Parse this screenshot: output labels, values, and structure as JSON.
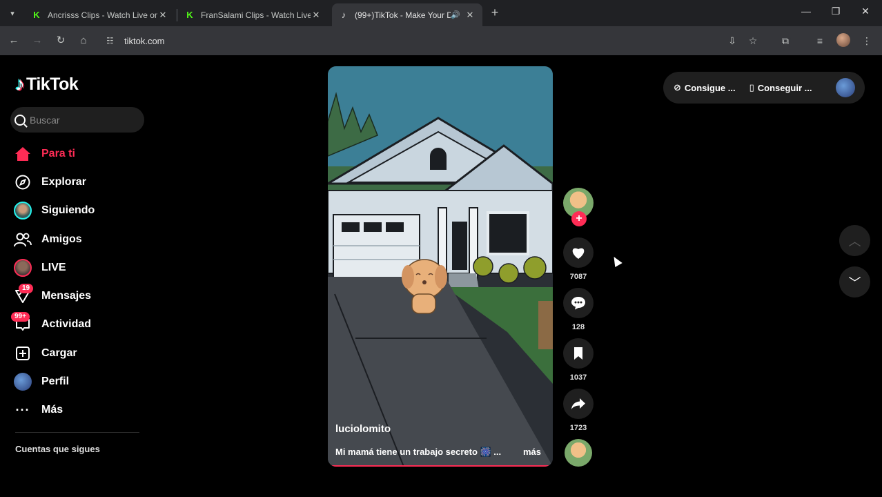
{
  "browser": {
    "tabs": [
      {
        "title": "Ancrisss Clips - Watch Live on K",
        "favicon": "kick-icon"
      },
      {
        "title": "FranSalami Clips - Watch Live o",
        "favicon": "kick-icon"
      },
      {
        "title": "(99+)TikTok - Make Your Da",
        "favicon": "tiktok-icon",
        "active": true
      }
    ],
    "url": "tiktok.com"
  },
  "sidebar": {
    "logo": "TikTok",
    "search_placeholder": "Buscar",
    "nav": [
      {
        "label": "Para ti",
        "icon": "home-icon",
        "active": true
      },
      {
        "label": "Explorar",
        "icon": "compass-icon"
      },
      {
        "label": "Siguiendo",
        "icon": "following-avatar"
      },
      {
        "label": "Amigos",
        "icon": "friends-icon"
      },
      {
        "label": "LIVE",
        "icon": "live-avatar"
      },
      {
        "label": "Mensajes",
        "icon": "messages-icon",
        "badge": "19"
      },
      {
        "label": "Actividad",
        "icon": "activity-icon",
        "badge": "99+"
      },
      {
        "label": "Cargar",
        "icon": "upload-icon"
      },
      {
        "label": "Perfil",
        "icon": "profile-avatar"
      },
      {
        "label": "Más",
        "icon": "more-icon"
      }
    ],
    "following_title": "Cuentas que sigues"
  },
  "video": {
    "author": "luciolomito",
    "description": "Mi mamá tiene un trabajo secreto 🎆 ...",
    "more_label": "más"
  },
  "actions": {
    "likes": "7087",
    "comments": "128",
    "saves": "1037",
    "shares": "1723"
  },
  "topbar": {
    "get_coins": "Consigue ...",
    "get_app": "Conseguir ..."
  },
  "colors": {
    "accent": "#fe2c55",
    "background": "#000000",
    "surface": "#1f1f1f"
  }
}
